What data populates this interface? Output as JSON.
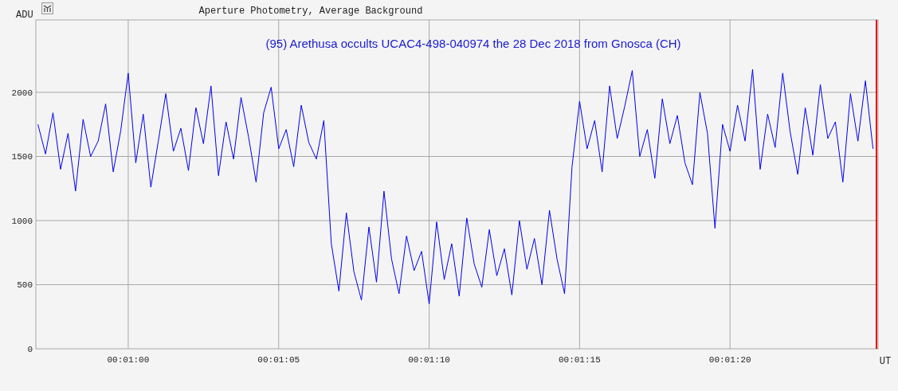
{
  "chart": {
    "chart_data": {
      "type": "line",
      "title": "Aperture Photometry, Average Background",
      "grid": true,
      "xlabel": "UT",
      "ylabel": "ADU",
      "annotations": [
        "(95) Arethusa occults UCAC4-498-040974 the 28 Dec 2018 from Gnosca (CH)"
      ],
      "xlim": [
        56.93,
        84.92
      ],
      "ylim": [
        0,
        2565
      ],
      "yticks": [
        2000,
        1500,
        1000,
        500,
        0
      ],
      "xticks": [
        {
          "value": 60,
          "label": "00:01:00"
        },
        {
          "value": 65,
          "label": "00:01:05"
        },
        {
          "value": 70,
          "label": "00:01:10"
        },
        {
          "value": 75,
          "label": "00:01:15"
        },
        {
          "value": 80,
          "label": "00:01:20"
        }
      ],
      "x": [
        57,
        57.25,
        57.5,
        57.75,
        58,
        58.25,
        58.5,
        58.75,
        59,
        59.25,
        59.5,
        59.75,
        60,
        60.25,
        60.5,
        60.75,
        61,
        61.25,
        61.5,
        61.75,
        62,
        62.25,
        62.5,
        62.75,
        63,
        63.25,
        63.5,
        63.75,
        64,
        64.25,
        64.5,
        64.75,
        65,
        65.25,
        65.5,
        65.75,
        66,
        66.25,
        66.5,
        66.75,
        67,
        67.25,
        67.5,
        67.75,
        68,
        68.25,
        68.5,
        68.75,
        69,
        69.25,
        69.5,
        69.75,
        70,
        70.25,
        70.5,
        70.75,
        71,
        71.25,
        71.5,
        71.75,
        72,
        72.25,
        72.5,
        72.75,
        73,
        73.25,
        73.5,
        73.75,
        74,
        74.25,
        74.5,
        74.75,
        75,
        75.25,
        75.5,
        75.75,
        76,
        76.25,
        76.5,
        76.75,
        77,
        77.25,
        77.5,
        77.75,
        78,
        78.25,
        78.5,
        78.75,
        79,
        79.25,
        79.5,
        79.75,
        80,
        80.25,
        80.5,
        80.75,
        81,
        81.25,
        81.5,
        81.75,
        82,
        82.25,
        82.5,
        82.75,
        83,
        83.25,
        83.5,
        83.75,
        84,
        84.25,
        84.5,
        84.75
      ],
      "series": [
        {
          "color": "#0000ee",
          "values": [
            1750,
            1520,
            1840,
            1400,
            1680,
            1230,
            1790,
            1500,
            1620,
            1910,
            1380,
            1700,
            2150,
            1450,
            1830,
            1260,
            1620,
            1990,
            1540,
            1720,
            1390,
            1880,
            1600,
            2050,
            1350,
            1770,
            1480,
            1960,
            1650,
            1300,
            1840,
            2040,
            1560,
            1710,
            1420,
            1900,
            1610,
            1480,
            1780,
            820,
            450,
            1060,
            600,
            380,
            950,
            520,
            1230,
            700,
            430,
            880,
            610,
            760,
            350,
            990,
            540,
            820,
            410,
            1020,
            660,
            480,
            930,
            570,
            780,
            420,
            1000,
            620,
            860,
            500,
            1080,
            700,
            430,
            1420,
            1930,
            1560,
            1780,
            1380,
            2050,
            1640,
            1890,
            2170,
            1500,
            1710,
            1330,
            1950,
            1600,
            1820,
            1450,
            1280,
            2000,
            1680,
            940,
            1750,
            1540,
            1900,
            1620,
            2180,
            1400,
            1830,
            1570,
            2150,
            1690,
            1360,
            1880,
            1510,
            2060,
            1640,
            1770,
            1300,
            1990,
            1620,
            2090,
            1560
          ]
        }
      ]
    }
  }
}
